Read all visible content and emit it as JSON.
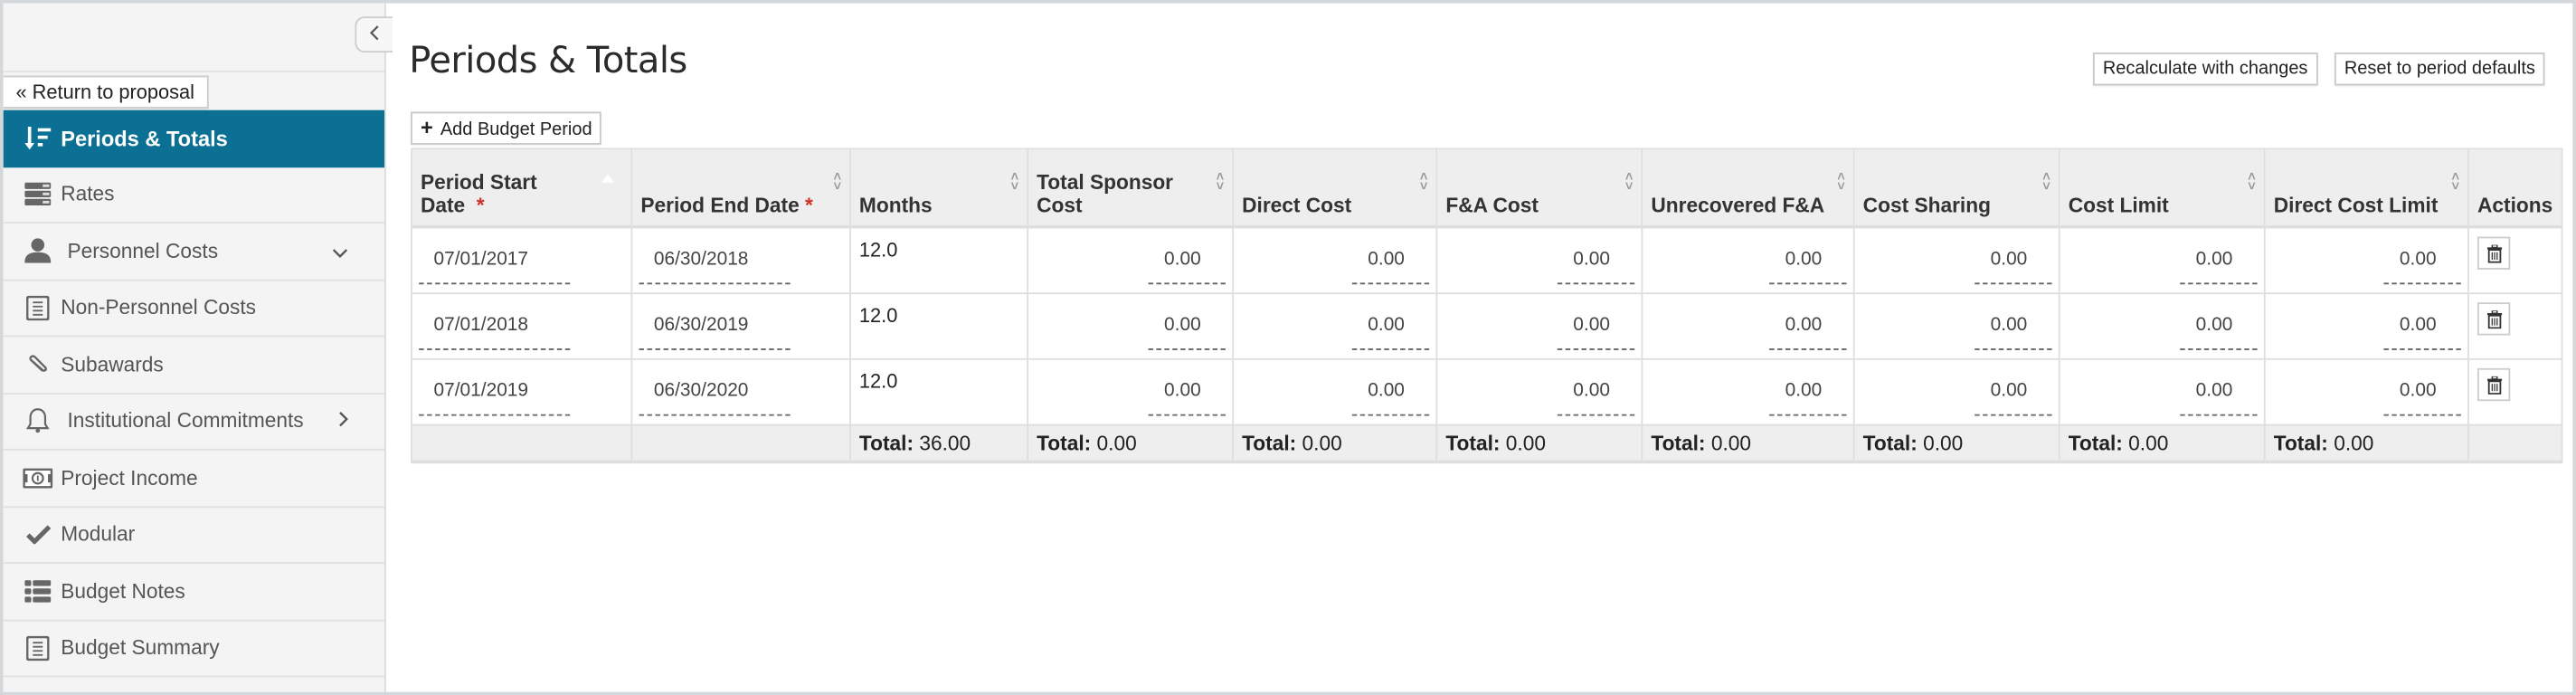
{
  "sidebar": {
    "collapse_icon": "chevron-left",
    "return_label": "« Return to proposal",
    "items": [
      {
        "label": "Periods & Totals",
        "icon": "sort-amount-down-icon",
        "active": true
      },
      {
        "label": "Rates",
        "icon": "server-icon"
      },
      {
        "label": "Personnel Costs",
        "icon": "user-icon",
        "chevron": "﹀"
      },
      {
        "label": "Non-Personnel Costs",
        "icon": "document-icon"
      },
      {
        "label": "Subawards",
        "icon": "paperclip-icon"
      },
      {
        "label": "Institutional Commitments",
        "icon": "bell-icon",
        "chevron": "›"
      },
      {
        "label": "Project Income",
        "icon": "money-bill-icon"
      },
      {
        "label": "Modular",
        "icon": "checkmark-icon"
      },
      {
        "label": "Budget Notes",
        "icon": "list-icon"
      },
      {
        "label": "Budget Summary",
        "icon": "document-icon"
      }
    ]
  },
  "main": {
    "title": "Periods & Totals",
    "recalc_label": "Recalculate with changes",
    "reset_label": "Reset to period defaults",
    "add_label": "Add Budget Period",
    "add_icon": "+",
    "required_marker": "*",
    "columns": [
      {
        "line1": "Period Start",
        "line2": "Date",
        "required": true,
        "sort": "asc"
      },
      {
        "line1": "",
        "line2": "Period End Date",
        "required": true,
        "sort": "both"
      },
      {
        "line1": "",
        "line2": "Months",
        "sort": "both"
      },
      {
        "line1": "",
        "line2": "Total Sponsor Cost",
        "sort": "both"
      },
      {
        "line1": "",
        "line2": "Direct Cost",
        "sort": "both"
      },
      {
        "line1": "",
        "line2": "F&A Cost",
        "sort": "both"
      },
      {
        "line1": "",
        "line2": "Unrecovered F&A",
        "sort": "both"
      },
      {
        "line1": "",
        "line2": "Cost Sharing",
        "sort": "both"
      },
      {
        "line1": "",
        "line2": "Cost Limit",
        "sort": "both"
      },
      {
        "line1": "",
        "line2": "Direct Cost Limit",
        "sort": "both"
      },
      {
        "line1": "",
        "line2": "Actions"
      }
    ],
    "rows": [
      {
        "start": "07/01/2017",
        "end": "06/30/2018",
        "months": "12.0",
        "total_sponsor": "0.00",
        "direct": "0.00",
        "fa": "0.00",
        "unrecovered": "0.00",
        "cost_sharing": "0.00",
        "cost_limit": "0.00",
        "direct_limit": "0.00"
      },
      {
        "start": "07/01/2018",
        "end": "06/30/2019",
        "months": "12.0",
        "total_sponsor": "0.00",
        "direct": "0.00",
        "fa": "0.00",
        "unrecovered": "0.00",
        "cost_sharing": "0.00",
        "cost_limit": "0.00",
        "direct_limit": "0.00"
      },
      {
        "start": "07/01/2019",
        "end": "06/30/2020",
        "months": "12.0",
        "total_sponsor": "0.00",
        "direct": "0.00",
        "fa": "0.00",
        "unrecovered": "0.00",
        "cost_sharing": "0.00",
        "cost_limit": "0.00",
        "direct_limit": "0.00"
      }
    ],
    "totals": {
      "label": "Total:",
      "months": "36.00",
      "total_sponsor": "0.00",
      "direct": "0.00",
      "fa": "0.00",
      "unrecovered": "0.00",
      "cost_sharing": "0.00",
      "cost_limit": "0.00",
      "direct_limit": "0.00"
    }
  },
  "colors": {
    "active_nav": "#0b7094",
    "required": "#d0302a",
    "header_bg": "#eeeeee",
    "sidebar_bg": "#f4f4f4"
  }
}
